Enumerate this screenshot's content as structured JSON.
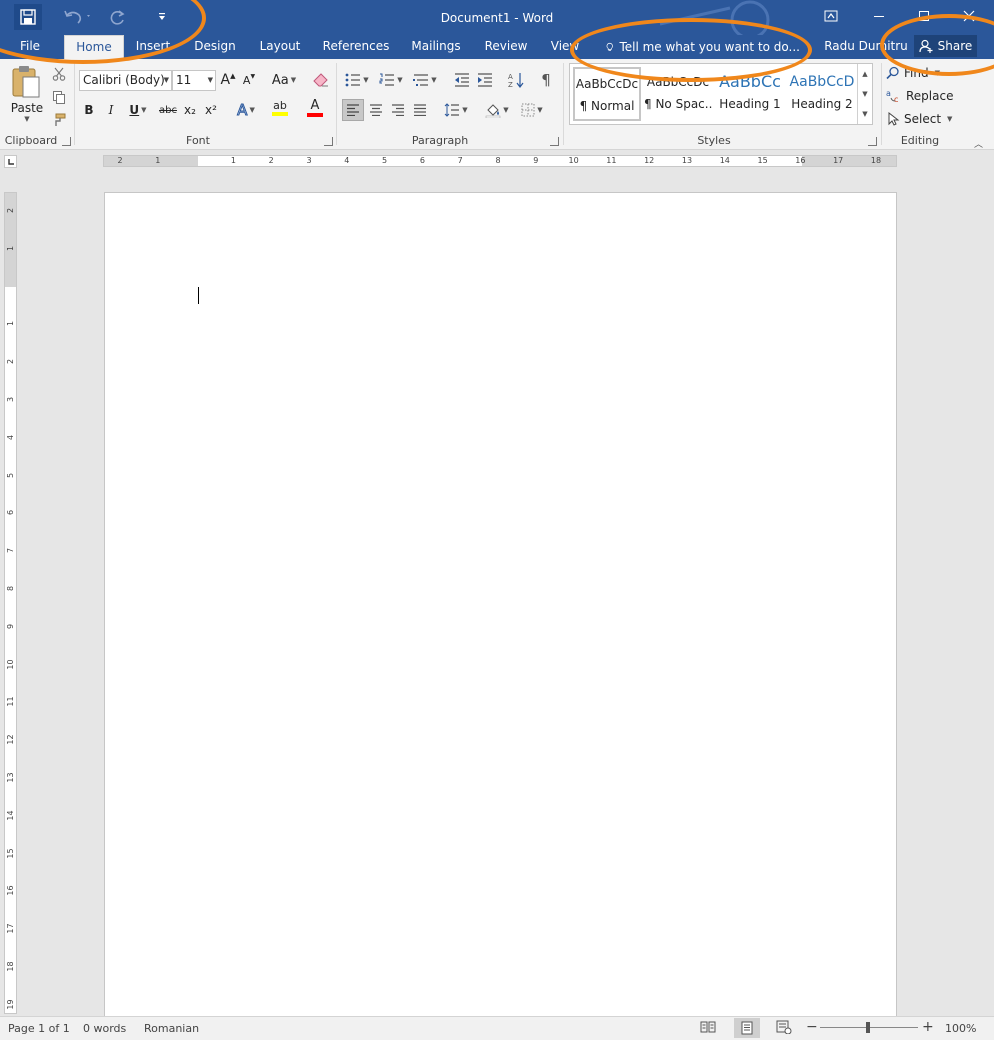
{
  "window": {
    "title": "Document1 - Word"
  },
  "quick_access": {
    "save": "save-icon",
    "undo": "undo-icon",
    "redo": "redo-icon",
    "customize": "customize-qat-icon"
  },
  "tabs": [
    "File",
    "Home",
    "Insert",
    "Design",
    "Layout",
    "References",
    "Mailings",
    "Review",
    "View"
  ],
  "active_tab": "Home",
  "tell_me": {
    "placeholder": "Tell me what you want to do..."
  },
  "user": {
    "name": "Radu Dumitru"
  },
  "share": {
    "label": "Share"
  },
  "clipboard": {
    "paste": "Paste",
    "group": "Clipboard"
  },
  "font": {
    "name": "Calibri (Body)",
    "size": "11",
    "grow": "A",
    "shrink": "A",
    "case": "Aa",
    "bold": "B",
    "italic": "I",
    "underline": "U",
    "strike": "abc",
    "subscript": "x₂",
    "superscript": "x²",
    "text_effects": "A",
    "highlight": "ab",
    "color": "A",
    "group": "Font"
  },
  "paragraph": {
    "group": "Paragraph",
    "pilcrow": "¶"
  },
  "styles": {
    "group": "Styles",
    "items": [
      {
        "preview": "AaBbCcDc",
        "name": "¶ Normal"
      },
      {
        "preview": "AaBbCcDc",
        "name": "¶ No Spac..."
      },
      {
        "preview": "AaBbCc",
        "name": "Heading 1"
      },
      {
        "preview": "AaBbCcD",
        "name": "Heading 2"
      }
    ]
  },
  "editing": {
    "find": "Find",
    "replace": "Replace",
    "select": "Select",
    "group": "Editing"
  },
  "ruler_h": [
    "2",
    "1",
    "",
    "1",
    "2",
    "3",
    "4",
    "5",
    "6",
    "7",
    "8",
    "9",
    "10",
    "11",
    "12",
    "13",
    "14",
    "15",
    "16",
    "17",
    "18"
  ],
  "ruler_v": [
    "2",
    "1",
    "",
    "1",
    "2",
    "3",
    "4",
    "5",
    "6",
    "7",
    "8",
    "9",
    "10",
    "11",
    "12",
    "13",
    "14",
    "15",
    "16",
    "17",
    "18",
    "19"
  ],
  "status": {
    "page": "Page 1 of 1",
    "words": "0 words",
    "language": "Romanian",
    "zoom": "100%"
  },
  "colors": {
    "brand": "#2b579a",
    "annotation": "#f0871b",
    "highlight": "#ffff00",
    "font_color": "#ff0000"
  }
}
